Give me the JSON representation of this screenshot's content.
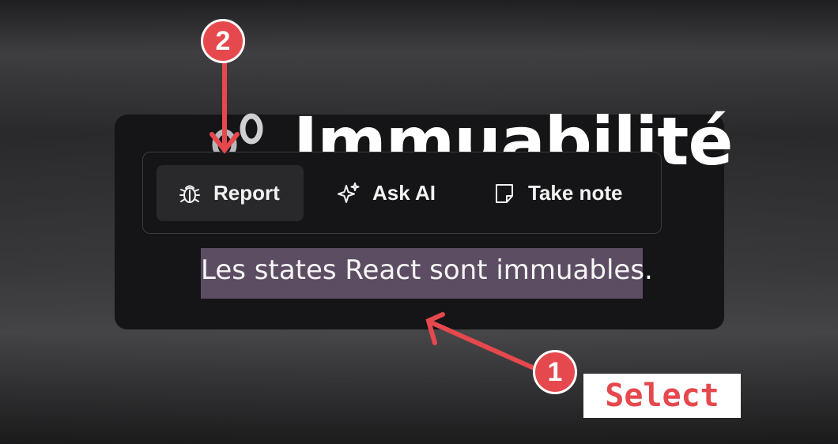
{
  "page": {
    "title": "Immuabilité",
    "selected_text": "Les states React sont immuables."
  },
  "toolbar": {
    "items": [
      {
        "label": "Report",
        "icon": "bug-icon"
      },
      {
        "label": "Ask AI",
        "icon": "sparkles-icon"
      },
      {
        "label": "Take note",
        "icon": "note-icon"
      }
    ]
  },
  "annotations": {
    "step1": "1",
    "step2": "2",
    "select_label": "Select"
  },
  "colors": {
    "accent": "#e5484d",
    "selection": "#5c4d63",
    "card": "#151518"
  }
}
